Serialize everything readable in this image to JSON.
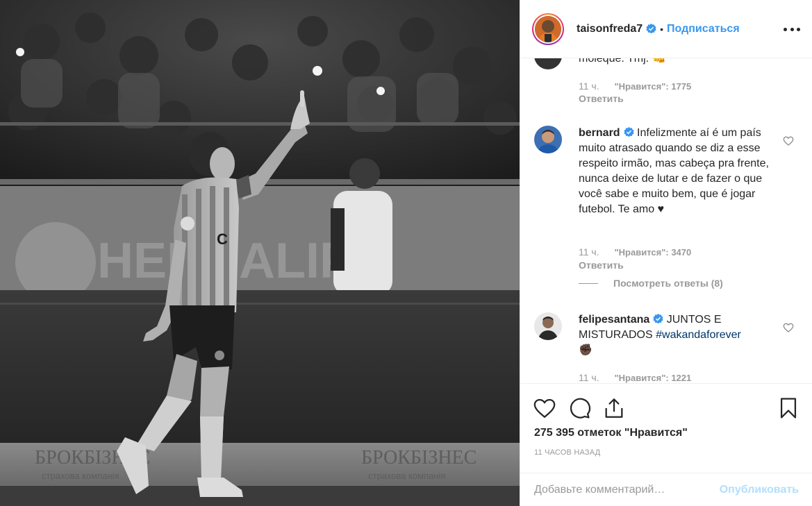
{
  "post": {
    "username": "taisonfreda7",
    "separator": "•",
    "follow_label": "Подписаться"
  },
  "comments": [
    {
      "text_fragment": "moleque. Tmj. 👊",
      "time": "11 ч.",
      "likes": "\"Нравится\": 1775",
      "reply_label": "Ответить"
    },
    {
      "username": "bernard",
      "text": "Infelizmente aí é um país muito atrasado quando se diz a esse respeito irmão, mas cabeça pra frente, nunca deixe de lutar e de fazer o que você sabe e muito bem, que é jogar futebol. Te amo ♥",
      "time": "11 ч.",
      "likes": "\"Нравится\": 3470",
      "reply_label": "Ответить",
      "view_replies": "Посмотреть ответы (8)"
    },
    {
      "username": "felipesantana",
      "text": "JUNTOS E MISTURADOS ",
      "hashtag": "#wakandaforever",
      "text_after": "✊🏿",
      "time": "11 ч.",
      "likes": "\"Нравится\": 1221"
    }
  ],
  "actions": {
    "icons": [
      "heart-icon",
      "comment-icon",
      "share-icon",
      "bookmark-icon"
    ],
    "likes_count": "275 395 отметок \"Нравится\"",
    "time_ago": "11 ЧАСОВ НАЗАД"
  },
  "comment_box": {
    "placeholder": "Добавьте комментарий…",
    "publish_label": "Опубликовать"
  },
  "photo_text": {
    "banner_left": "БРОКБІЗНЕС",
    "banner_left_sub": "страхова компанія",
    "banner_right": "БРОКБІЗНЕС",
    "banner_right_sub": "страхова компанія"
  },
  "colors": {
    "accent": "#3897f0",
    "verified": "#3897f0",
    "muted": "#999999",
    "text": "#262626",
    "publish_disabled": "#b2dffc"
  }
}
